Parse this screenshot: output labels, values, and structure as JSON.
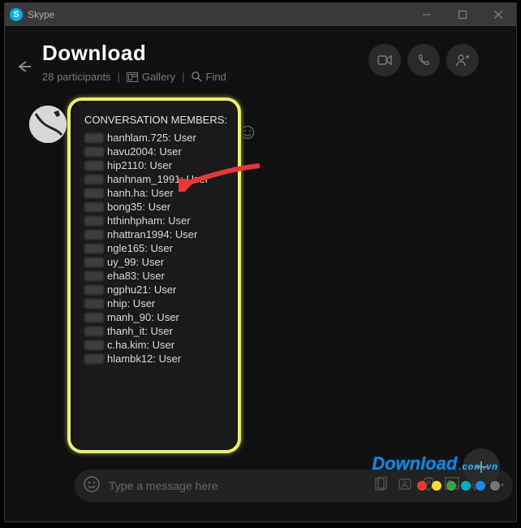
{
  "app": {
    "name": "Skype"
  },
  "header": {
    "title": "Download",
    "participants": "28 participants",
    "gallery": "Gallery",
    "find": "Find"
  },
  "members_panel": {
    "title": "CONVERSATION MEMBERS:",
    "items": [
      "hanhlam.725: User",
      "havu2004: User",
      "hip2110: User",
      "hanhnam_1991: User",
      "hanh.ha: User",
      "bong35: User",
      "hthinhpham: User",
      "nhattran1994: User",
      "ngle165: User",
      "uy_99: User",
      "eha83: User",
      "ngphu21: User",
      "nhip: User",
      "manh_90: User",
      "thanh_it: User",
      "c.ha.kim: User",
      "hlambk12: User"
    ]
  },
  "composer": {
    "placeholder": "Type a message here"
  },
  "watermark": {
    "brand": "Download",
    "domain": ".com.vn"
  },
  "dot_colors": [
    "#e53935",
    "#fdd835",
    "#43a047",
    "#00acc1",
    "#1e88e5",
    "#757575"
  ]
}
